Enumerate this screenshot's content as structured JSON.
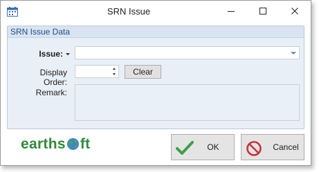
{
  "window": {
    "title": "SRN Issue"
  },
  "panel": {
    "title": "SRN Issue Data"
  },
  "form": {
    "issue_label": "Issue:",
    "issue_value": "",
    "display_order_label": "Display Order:",
    "display_order_value": "",
    "clear_label": "Clear",
    "remark_label": "Remark:",
    "remark_value": ""
  },
  "footer": {
    "logo_text_before": "earths",
    "logo_text_after": "ft",
    "ok_label": "OK",
    "cancel_label": "Cancel"
  },
  "colors": {
    "accent": "#1c4d8a",
    "logo": "#2e8b3a",
    "ok": "#3aa046",
    "cancel": "#c8323c"
  }
}
